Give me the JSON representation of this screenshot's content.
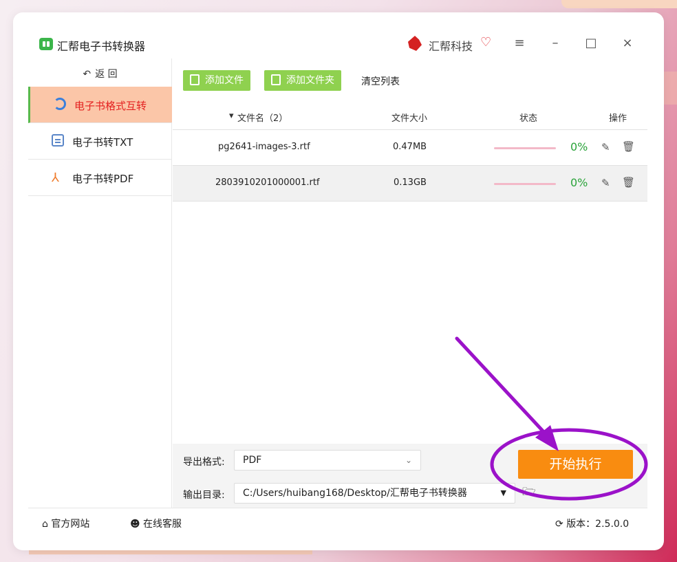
{
  "window": {
    "title": "汇帮电子书转换器",
    "brand": "汇帮科技",
    "controls": {
      "menu": "≡",
      "minimize": "–",
      "maximize": "□",
      "close": "×"
    }
  },
  "sidebar": {
    "back": {
      "arrow": "↶",
      "label": "返 回"
    },
    "items": [
      {
        "label": "电子书格式互转",
        "icon": "sync-icon",
        "active": true
      },
      {
        "label": "电子书转TXT",
        "icon": "document-icon",
        "active": false
      },
      {
        "label": "电子书转PDF",
        "icon": "pdf-icon",
        "active": false
      }
    ]
  },
  "toolbar": {
    "add_file": "添加文件",
    "add_folder": "添加文件夹",
    "clear_list": "清空列表"
  },
  "table": {
    "headers": {
      "sort_arrow": "▾",
      "filename": "文件名（2）",
      "size": "文件大小",
      "status": "状态",
      "actions": "操作"
    },
    "rows": [
      {
        "filename": "pg2641-images-3.rtf",
        "size": "0.47MB",
        "progress": 0,
        "percent": "0%"
      },
      {
        "filename": "2803910201000001.rtf",
        "size": "0.13GB",
        "progress": 0,
        "percent": "0%"
      }
    ]
  },
  "output": {
    "format_label": "导出格式:",
    "format_value": "PDF",
    "dir_label": "输出目录:",
    "dir_value": "C:/Users/huibang168/Desktop/汇帮电子书转换器",
    "start_button": "开始执行"
  },
  "footer": {
    "website": "官方网站",
    "support": "在线客服",
    "version": "版本：2.5.0.0"
  },
  "colors": {
    "accent_green": "#8fd14f",
    "active_bg": "#fbc6a8",
    "active_text": "#e42121",
    "start_orange": "#f98c10",
    "annotation_purple": "#9b12c9"
  }
}
